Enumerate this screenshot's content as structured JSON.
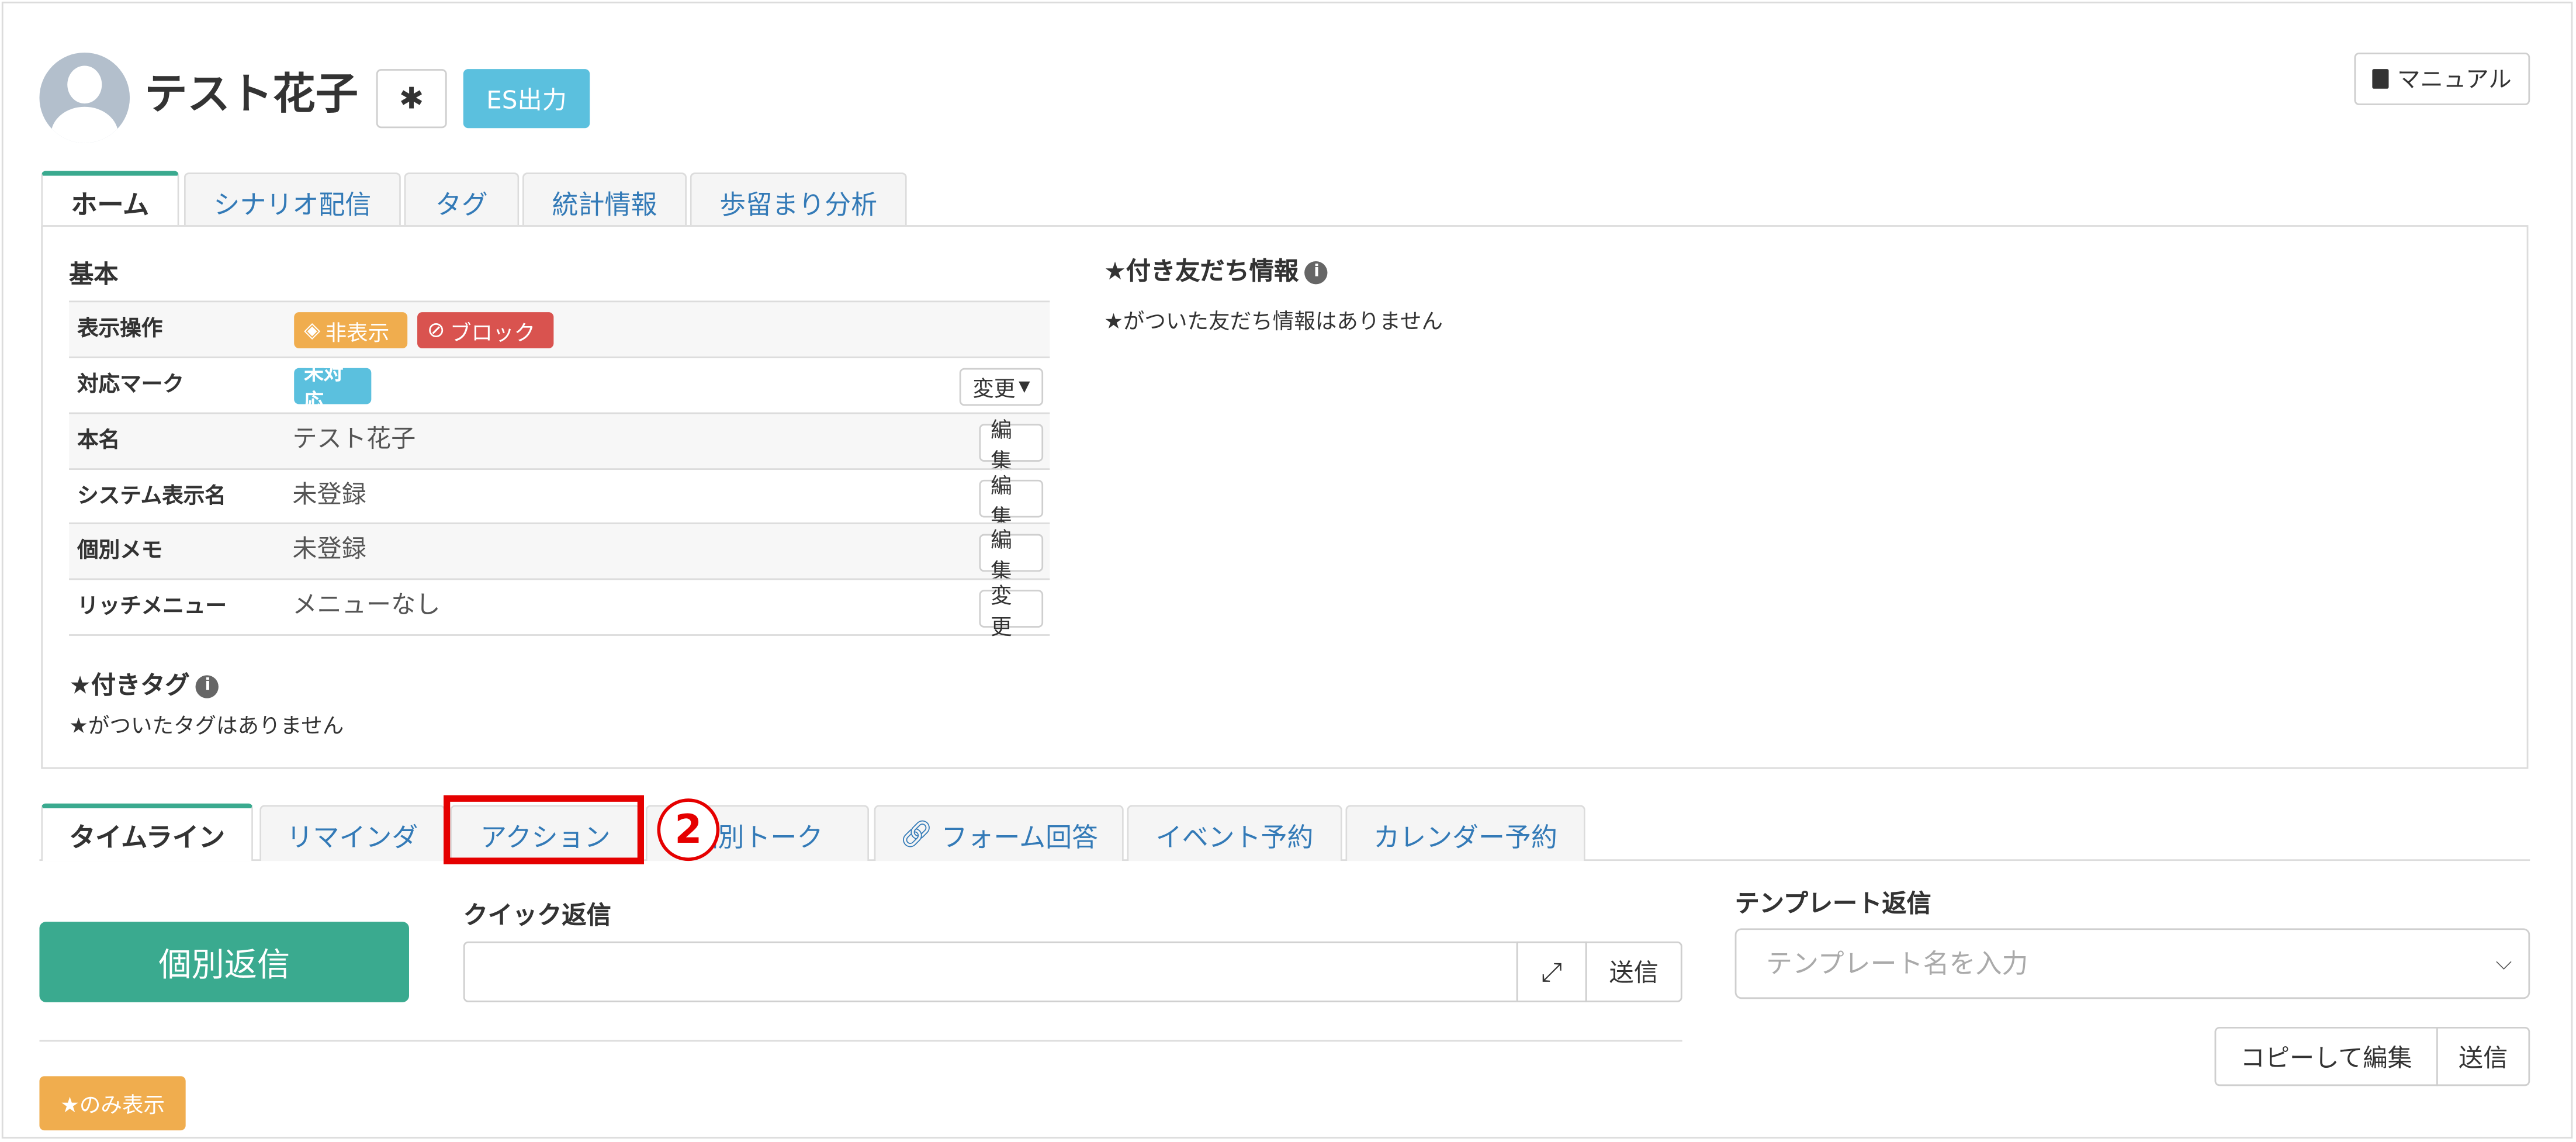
{
  "header": {
    "user_name": "テスト花子",
    "es_button": "ES出力",
    "manual_button": "マニュアル"
  },
  "top_tabs": [
    "ホーム",
    "シナリオ配信",
    "タグ",
    "統計情報",
    "歩留まり分析"
  ],
  "basic": {
    "title": "基本",
    "rows": [
      {
        "label": "表示操作",
        "hide_label": "非表示",
        "block_label": "ブロック"
      },
      {
        "label": "対応マーク",
        "badge": "未対応",
        "action": "変更"
      },
      {
        "label": "本名",
        "value": "テスト花子",
        "action": "編集"
      },
      {
        "label": "システム表示名",
        "value": "未登録",
        "action": "編集"
      },
      {
        "label": "個別メモ",
        "value": "未登録",
        "action": "編集"
      },
      {
        "label": "リッチメニュー",
        "value": "メニューなし",
        "action": "変更"
      }
    ]
  },
  "starred_tags": {
    "title": "★付きタグ",
    "empty": "★がついたタグはありません"
  },
  "friend_info": {
    "title": "★付き友だち情報",
    "empty": "★がついた友だち情報はありません"
  },
  "bottom_tabs": [
    "タイムライン",
    "リマインダ",
    "アクション",
    "個別トーク",
    "フォーム回答",
    "イベント予約",
    "カレンダー予約"
  ],
  "annotation_number": "2",
  "reply": {
    "button": "個別返信",
    "quick_label": "クイック返信",
    "send": "送信"
  },
  "template": {
    "label": "テンプレート返信",
    "placeholder": "テンプレート名を入力",
    "copy_edit": "コピーして編集",
    "send": "送信"
  },
  "star_only_button": "★のみ表示",
  "colors": {
    "accent_green": "#3aaa8f",
    "info_blue": "#5bc0de",
    "warning_orange": "#f0ad4e",
    "danger_red": "#d9534f",
    "annotation_red": "#e50000"
  }
}
